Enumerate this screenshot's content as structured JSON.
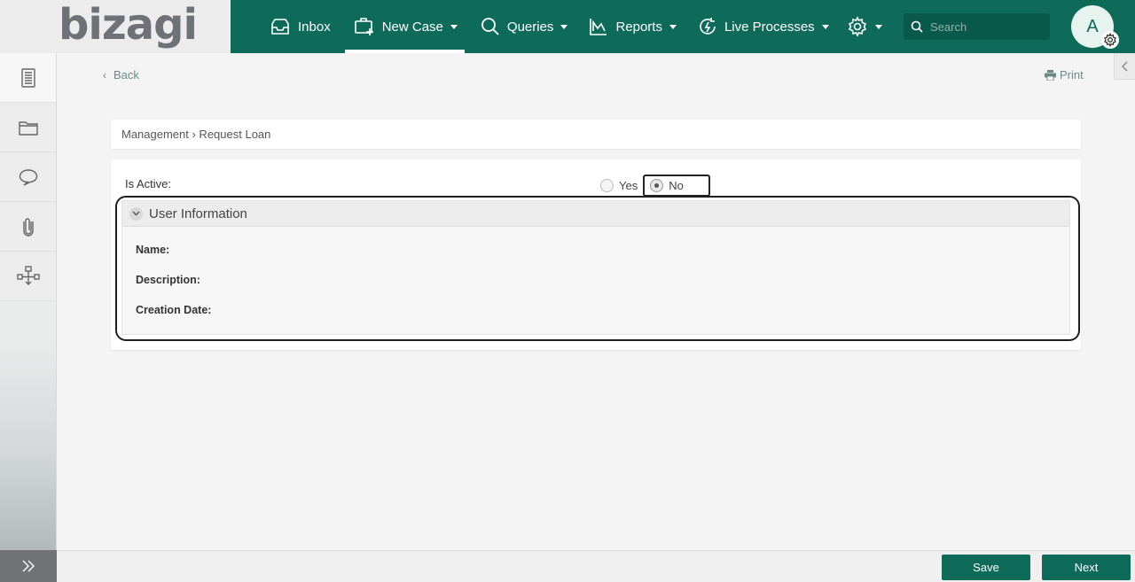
{
  "brand": {
    "logo": "bizagi"
  },
  "nav": {
    "items": [
      {
        "label": "Inbox",
        "icon": "inbox-icon",
        "dropdown": false,
        "active": false
      },
      {
        "label": "New Case",
        "icon": "new-case-icon",
        "dropdown": true,
        "active": true
      },
      {
        "label": "Queries",
        "icon": "search-icon",
        "dropdown": true,
        "active": false
      },
      {
        "label": "Reports",
        "icon": "reports-icon",
        "dropdown": true,
        "active": false
      }
    ],
    "live_processes": "Live Processes"
  },
  "search": {
    "placeholder": "Search"
  },
  "user": {
    "initial": "A"
  },
  "sidebar": {
    "icons": [
      "case-details-icon",
      "folder-icon",
      "comments-icon",
      "attachment-icon",
      "process-map-icon"
    ]
  },
  "page": {
    "back_label": "Back",
    "print_label": "Print",
    "breadcrumb": "Management › Request Loan"
  },
  "form": {
    "is_active_label": "Is Active:",
    "options": {
      "yes": "Yes",
      "no": "No"
    },
    "selected": "No",
    "group_title": "User Information",
    "fields": {
      "name": "Name:",
      "description": "Description:",
      "creation_date": "Creation Date:"
    }
  },
  "actions": {
    "save": "Save",
    "next": "Next"
  },
  "colors": {
    "primary": "#0e6b5a",
    "nav_bg": "#0e6b5a",
    "accent_text": "#6b8a84"
  }
}
